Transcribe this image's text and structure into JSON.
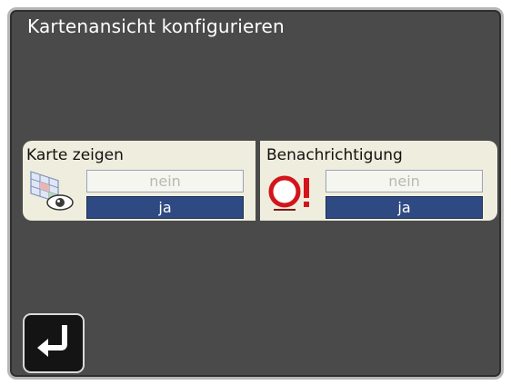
{
  "screen": {
    "title": "Kartenansicht konfigurieren"
  },
  "settings": [
    {
      "label": "Karte zeigen",
      "icon": "map-eye-icon",
      "options": [
        "nein",
        "ja"
      ],
      "selected": "ja"
    },
    {
      "label": "Benachrichtigung",
      "icon": "warning-sign-icon",
      "options": [
        "nein",
        "ja"
      ],
      "selected": "ja"
    }
  ],
  "footer": {
    "back_icon": "return-arrow-icon"
  },
  "colors": {
    "background": "#4a4a4a",
    "panel": "#efeddd",
    "selected": "#2f4a82",
    "unselected_text": "#b9b9b3"
  }
}
